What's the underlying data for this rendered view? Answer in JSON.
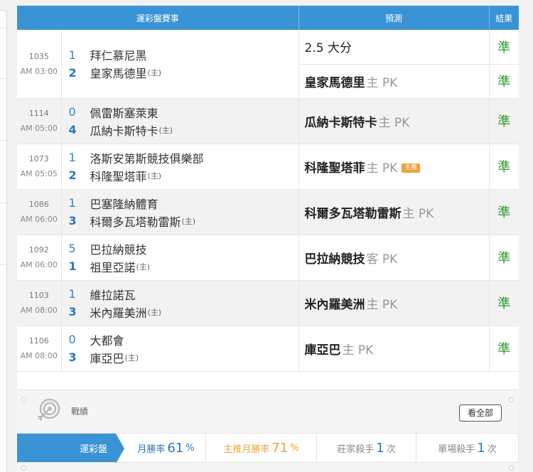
{
  "table": {
    "headers": {
      "match": "運彩盤賽事",
      "prediction": "預測",
      "result": "結果"
    },
    "rows": [
      {
        "id": "1035",
        "time": "AM 03:00",
        "teams": [
          {
            "score": "1",
            "name": "拜仁慕尼黑",
            "home_tag": ""
          },
          {
            "score": "2",
            "name": "皇家馬德里",
            "home_tag": "(主)"
          }
        ],
        "predictions": [
          {
            "main": "2.5 大分",
            "tag": "",
            "badge": "",
            "result": "準"
          },
          {
            "main": "皇家馬德里",
            "tag": "主 PK",
            "badge": "",
            "result": "準"
          }
        ]
      },
      {
        "id": "1114",
        "time": "AM 05:00",
        "teams": [
          {
            "score": "0",
            "name": "佩雷斯塞萊東",
            "home_tag": ""
          },
          {
            "score": "4",
            "name": "瓜納卡斯特卡",
            "home_tag": "(主)"
          }
        ],
        "predictions": [
          {
            "main": "瓜納卡斯特卡",
            "tag": "主 PK",
            "badge": "",
            "result": "準"
          }
        ]
      },
      {
        "id": "1073",
        "time": "AM 05:05",
        "teams": [
          {
            "score": "1",
            "name": "洛斯安第斯競技俱樂部",
            "home_tag": ""
          },
          {
            "score": "2",
            "name": "科隆聖塔菲",
            "home_tag": "(主)"
          }
        ],
        "predictions": [
          {
            "main": "科隆聖塔菲",
            "tag": "主 PK",
            "badge": "主推",
            "result": "準"
          }
        ]
      },
      {
        "id": "1086",
        "time": "AM 06:00",
        "teams": [
          {
            "score": "1",
            "name": "巴塞隆納體育",
            "home_tag": ""
          },
          {
            "score": "3",
            "name": "科爾多瓦塔勒雷斯",
            "home_tag": "(主)"
          }
        ],
        "predictions": [
          {
            "main": "科爾多瓦塔勒雷斯",
            "tag": "主 PK",
            "badge": "",
            "result": "準"
          }
        ]
      },
      {
        "id": "1092",
        "time": "AM 06:00",
        "teams": [
          {
            "score": "5",
            "name": "巴拉納競技",
            "home_tag": ""
          },
          {
            "score": "1",
            "name": "祖里亞諾",
            "home_tag": "(主)"
          }
        ],
        "predictions": [
          {
            "main": "巴拉納競技",
            "tag": "客 PK",
            "badge": "",
            "result": "準"
          }
        ]
      },
      {
        "id": "1103",
        "time": "AM 08:00",
        "teams": [
          {
            "score": "1",
            "name": "維拉諾瓦",
            "home_tag": ""
          },
          {
            "score": "3",
            "name": "米內羅美洲",
            "home_tag": "(主)"
          }
        ],
        "predictions": [
          {
            "main": "米內羅美洲",
            "tag": "主 PK",
            "badge": "",
            "result": "準"
          }
        ]
      },
      {
        "id": "1106",
        "time": "AM 08:00",
        "teams": [
          {
            "score": "0",
            "name": "大都會",
            "home_tag": ""
          },
          {
            "score": "3",
            "name": "庫亞巴",
            "home_tag": "(主)"
          }
        ],
        "predictions": [
          {
            "main": "庫亞巴",
            "tag": "主 PK",
            "badge": "",
            "result": "準"
          }
        ]
      }
    ]
  },
  "stats": {
    "title": "戰績",
    "view_all": "看全部",
    "tab_label": "運彩盤",
    "monthly_win_label": "月勝率",
    "monthly_win_value": "61",
    "featured_win_label": "主推月勝率",
    "featured_win_value": "71",
    "percent": "%",
    "banker_killer_label": "莊家殺手",
    "banker_killer_value": "1",
    "single_killer_label": "單場殺手",
    "single_killer_value": "1",
    "times_unit": "次"
  },
  "colors": {
    "header_blue": "#3a93d5",
    "win_green": "#2a9a2a",
    "featured_orange": "#f0a23a",
    "score_blue": "#2a78bd"
  },
  "icons": {
    "target": "target-icon"
  }
}
